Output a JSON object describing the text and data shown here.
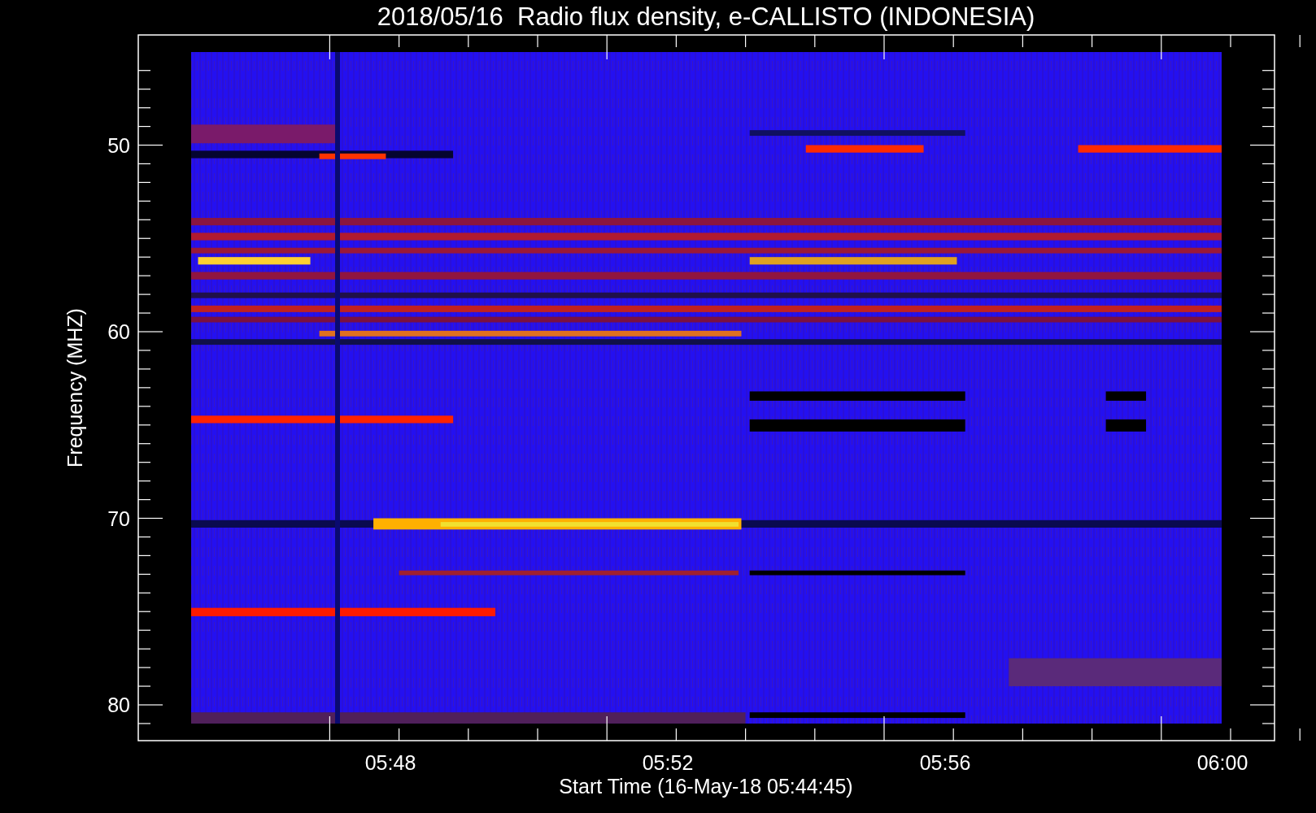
{
  "title": "2018/05/16  Radio flux density, e-CALLISTO (INDONESIA)",
  "y_axis": {
    "label": "Frequency (MHZ)",
    "ticks": [
      "50",
      "60",
      "70",
      "80"
    ]
  },
  "x_axis": {
    "label": "Start Time (16-May-18 05:44:45)",
    "ticks": [
      "05:48",
      "05:52",
      "05:56",
      "06:00"
    ]
  }
}
